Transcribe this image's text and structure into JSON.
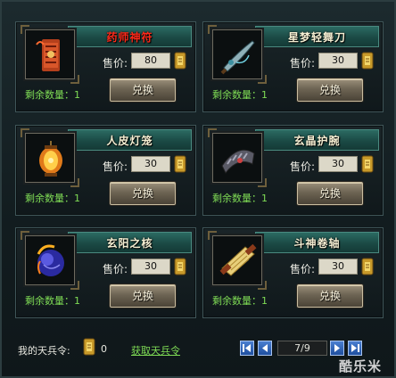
{
  "items": [
    {
      "name": "药师神符",
      "price": "80",
      "remaining_label": "剩余数量：1",
      "button": "兑换",
      "title_color": "#ff2a1a"
    },
    {
      "name": "星梦轻舞刀",
      "price": "30",
      "remaining_label": "剩余数量：1",
      "button": "兑换"
    },
    {
      "name": "人皮灯笼",
      "price": "30",
      "remaining_label": "剩余数量：1",
      "button": "兑换"
    },
    {
      "name": "玄晶护腕",
      "price": "30",
      "remaining_label": "剩余数量：1",
      "button": "兑换"
    },
    {
      "name": "玄阳之核",
      "price": "30",
      "remaining_label": "剩余数量：1",
      "button": "兑换"
    },
    {
      "name": "斗神卷轴",
      "price": "30",
      "remaining_label": "剩余数量：1",
      "button": "兑换"
    }
  ],
  "price_label": "售价:",
  "footer": {
    "token_label": "我的天兵令:",
    "token_count": "0",
    "get_link": "获取天兵令",
    "page": "7/9"
  },
  "watermark": "酷乐米",
  "colors": {
    "header_green": "#2b6a62",
    "remaining_green": "#7fdc55",
    "title_red": "#ff2a1a",
    "title_light": "#f4eed2",
    "pager_blue": "#1f4fa0"
  },
  "icons": [
    "talisman-icon",
    "sword-icon",
    "lantern-icon",
    "wristguard-icon",
    "orb-icon",
    "scroll-icon",
    "token-icon",
    "first-page-icon",
    "prev-page-icon",
    "next-page-icon",
    "last-page-icon"
  ]
}
